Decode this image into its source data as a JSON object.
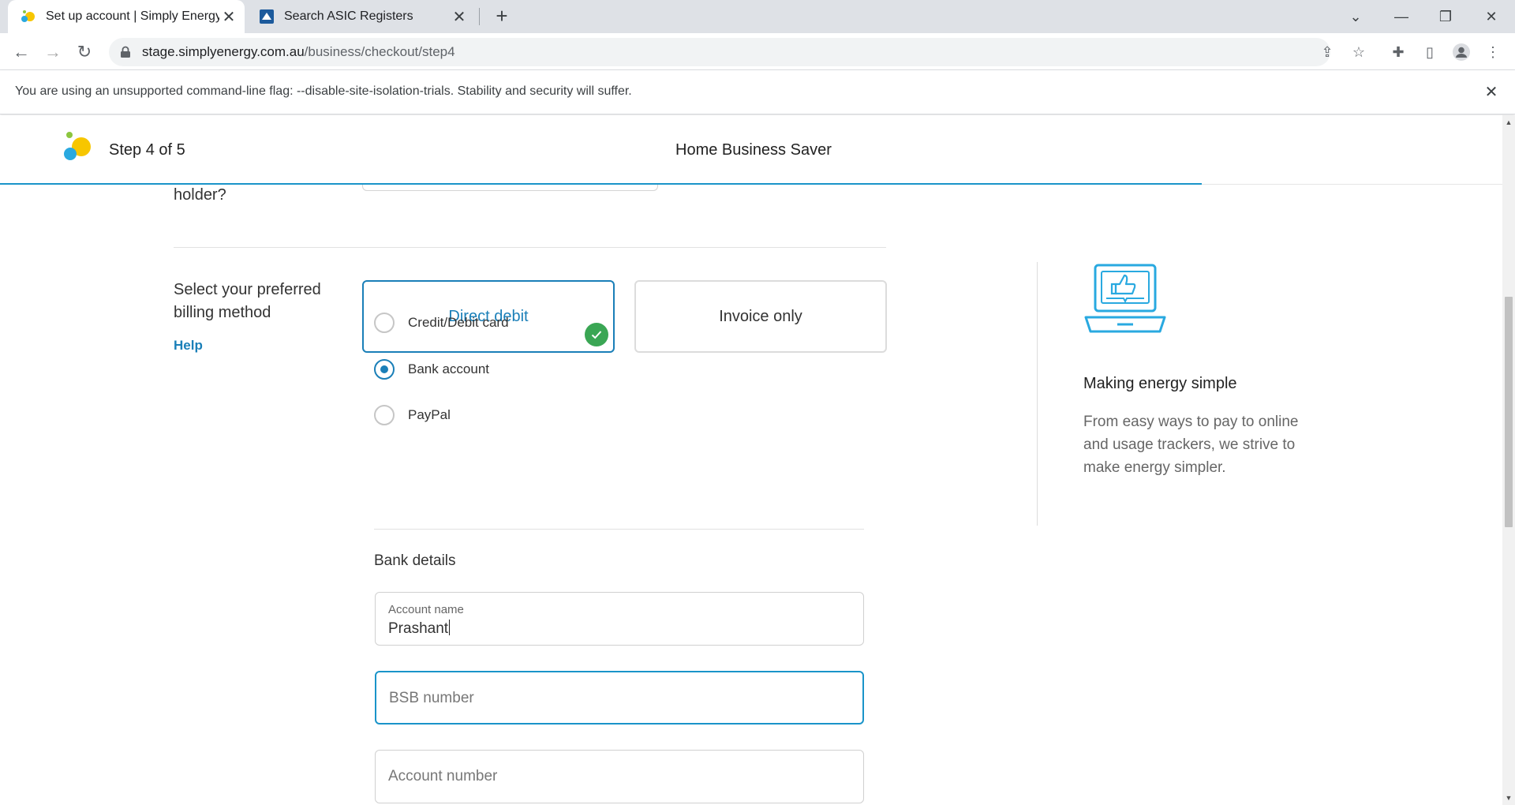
{
  "browser": {
    "tabs": [
      {
        "title": "Set up account | Simply Energy",
        "active": true
      },
      {
        "title": "Search ASIC Registers",
        "active": false
      }
    ],
    "new_tab": "+",
    "url_host": "stage.simplyenergy.com.au",
    "url_path": "/business/checkout/step4",
    "infobar_message": "You are using an unsupported command-line flag: --disable-site-isolation-trials. Stability and security will suffer.",
    "icons": {
      "back": "back-arrow-icon",
      "forward": "forward-arrow-icon",
      "reload": "reload-icon",
      "share": "share-icon",
      "bookmark": "star-icon",
      "extensions": "puzzle-icon",
      "side_panel": "side-panel-icon",
      "profile": "profile-icon",
      "menu": "kebab-menu-icon"
    }
  },
  "header": {
    "step": "Step 4 of 5",
    "plan": "Home Business Saver",
    "progress_fraction": 0.8
  },
  "form": {
    "holder_question_tail": "holder?",
    "billing_label": "Select your preferred billing method",
    "help": "Help",
    "billing_options": [
      {
        "label": "Direct debit",
        "selected": true
      },
      {
        "label": "Invoice only",
        "selected": false
      }
    ],
    "payment_methods": [
      {
        "label": "Credit/Debit card",
        "selected": false
      },
      {
        "label": "Bank account",
        "selected": true
      },
      {
        "label": "PayPal",
        "selected": false
      }
    ],
    "bank_title": "Bank details",
    "account_name": {
      "label": "Account name",
      "value": "Prashant"
    },
    "bsb": {
      "placeholder": "BSB number"
    },
    "account_number": {
      "placeholder": "Account number"
    }
  },
  "sidebar": {
    "title": "Making energy simple",
    "text": "From easy ways to pay to online and usage trackers, we strive to make energy simpler.",
    "illustration": "laptop-thumbs-up-icon"
  },
  "colors": {
    "accent": "#1a7fb8",
    "progress": "#1a94c9",
    "success": "#3aa654"
  }
}
